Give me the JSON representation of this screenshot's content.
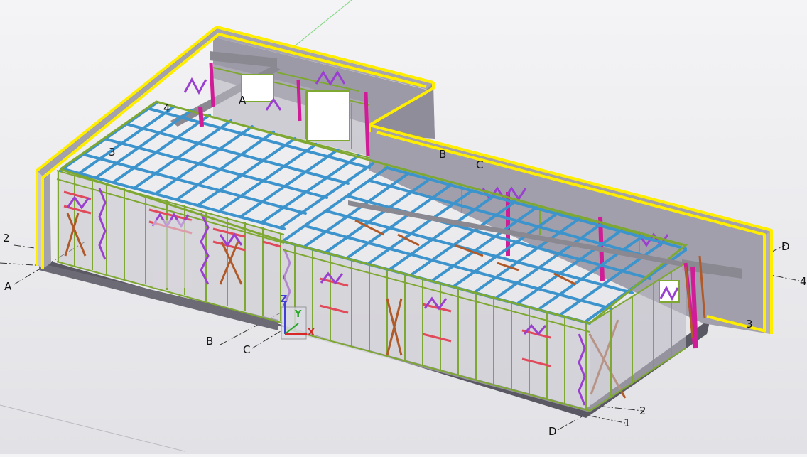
{
  "grid_labels": {
    "A_left": "A",
    "A_back": "A",
    "B_front": "B",
    "B_back": "B",
    "C_front": "C",
    "C_back": "C",
    "D_right": "D",
    "D_bottom": "D",
    "g2_left": "2",
    "g2_right": "2",
    "g4_right": "4",
    "g4_back": "4",
    "g3_right": "3",
    "g3_back": "3",
    "g1_bottom": "1"
  },
  "axes": {
    "z": "Z",
    "y": "Y",
    "x": "X"
  },
  "colors": {
    "perimeter_wall": "#9c9aa6",
    "wall_outline": "#ffee00",
    "stud_frame": "#7ea832",
    "joist": "#3d94cc",
    "joist_dark": "#1f6fa8",
    "bracing_purple": "#9a3fcf",
    "brace_brown": "#b05a2a",
    "column_magenta": "#d01c96",
    "lintel_red": "#e04a5a",
    "beam_grey": "#8a8890",
    "slab_dark": "#55535c"
  }
}
